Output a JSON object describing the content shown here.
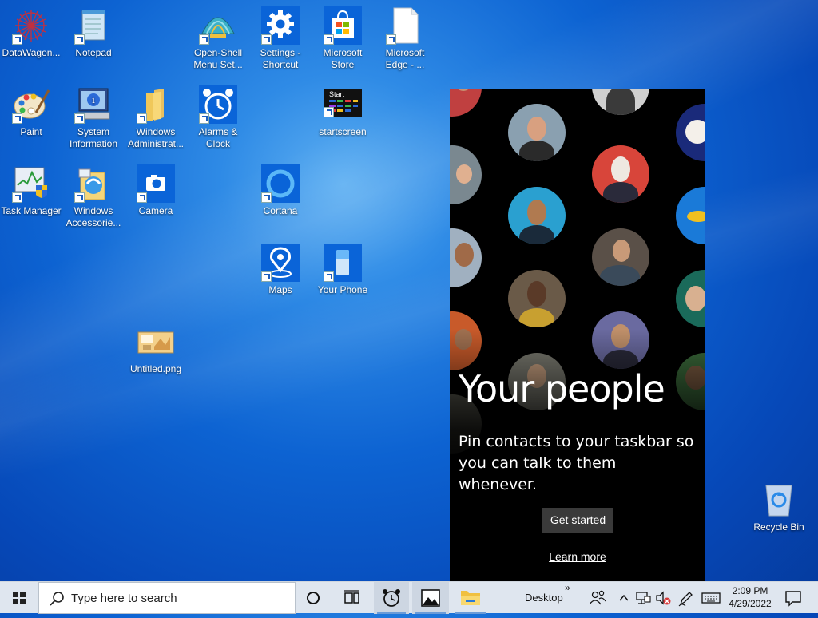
{
  "desktop": {
    "icons": [
      {
        "label": "DataWagon..."
      },
      {
        "label": "Notepad"
      },
      {
        "label": "Open-Shell Menu Set..."
      },
      {
        "label": "Settings - Shortcut"
      },
      {
        "label": "Microsoft Store"
      },
      {
        "label": "Microsoft Edge - ..."
      },
      {
        "label": "Paint"
      },
      {
        "label": "System Information"
      },
      {
        "label": "Windows Administrat..."
      },
      {
        "label": "Alarms & Clock"
      },
      {
        "label": "startscreen"
      },
      {
        "label": "Task Manager"
      },
      {
        "label": "Windows Accessorie..."
      },
      {
        "label": "Camera"
      },
      {
        "label": "Cortana"
      },
      {
        "label": "Maps"
      },
      {
        "label": "Your Phone"
      },
      {
        "label": "Untitled.png"
      },
      {
        "label": "Recycle Bin"
      }
    ],
    "startscreen_thumb_text": "Start"
  },
  "people_panel": {
    "title": "Your people",
    "description": "Pin contacts to your taskbar so you can talk to them whenever.",
    "get_started": "Get started",
    "learn_more": "Learn more"
  },
  "taskbar": {
    "search_placeholder": "Type here to search",
    "toolbar_label": "Desktop",
    "toolbar_chevron": "»",
    "time": "2:09 PM",
    "date": "4/29/2022",
    "icons": [
      "windows-start-icon",
      "search-icon",
      "cortana-icon",
      "task-view-icon",
      "alarms-clock-icon",
      "photos-icon",
      "file-explorer-icon",
      "people-icon",
      "show-hidden-icons-chevron",
      "network-icon",
      "volume-muted-icon",
      "pen-icon",
      "touch-keyboard-icon",
      "action-center-icon"
    ]
  },
  "colors": {
    "desktop_blue": "#0d63d2",
    "taskbar": "#dfe6ef",
    "panel_bg": "#000000",
    "button_bg": "#3a3a3a"
  }
}
